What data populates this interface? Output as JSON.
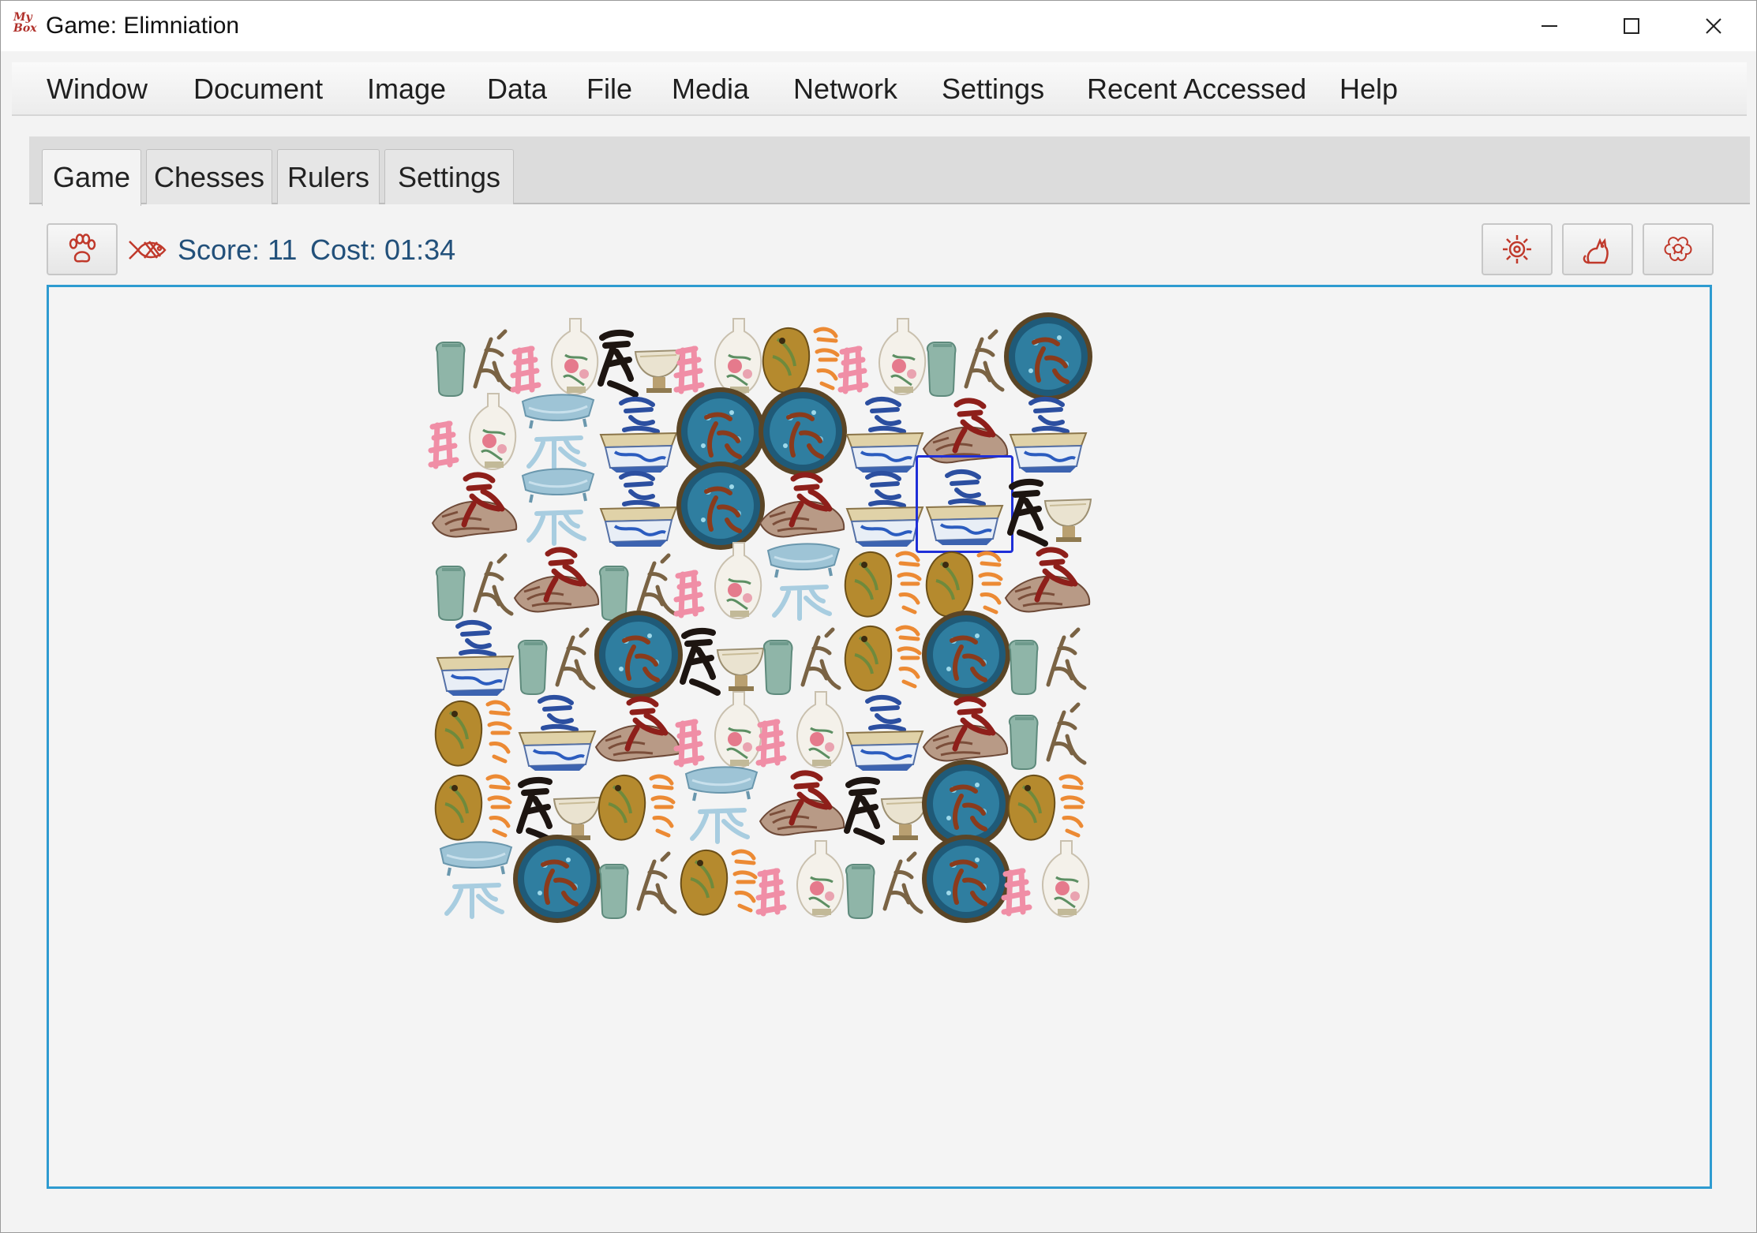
{
  "window": {
    "logo_text": "My Box",
    "title": "Game: Elimniation"
  },
  "menu": [
    "Window",
    "Document",
    "Image",
    "Data",
    "File",
    "Media",
    "Network",
    "Settings",
    "Recent Accessed",
    "Help"
  ],
  "tabs": [
    {
      "label": "Game",
      "active": true
    },
    {
      "label": "Chesses",
      "active": false
    },
    {
      "label": "Rulers",
      "active": false
    },
    {
      "label": "Settings",
      "active": false
    }
  ],
  "toolbar": {
    "left_button_icon": "paw-icon",
    "status_icon": "fish-icon",
    "score_text": "Score: 11",
    "cost_text": "Cost: 01:34",
    "right_buttons": [
      "gear-icon",
      "cat-icon",
      "peony-icon"
    ]
  },
  "colors": {
    "accent": "#c0392b",
    "board_border": "#2e9bd0",
    "selected_border": "#1f2fd8",
    "status_text": "#22507a"
  },
  "board": {
    "rows": 8,
    "cols": 8,
    "selected": {
      "row": 2,
      "col": 6
    },
    "piece_types": [
      "celadon-jar-piece",
      "famille-rose-vase-piece",
      "crackle-bowl-piece",
      "oil-spot-bowl-piece",
      "bronze-fish-vessel-piece",
      "blue-white-basin-piece",
      "conch-shell-piece",
      "pale-dish-piece"
    ],
    "grid": [
      [
        0,
        1,
        2,
        1,
        4,
        1,
        0,
        3
      ],
      [
        1,
        7,
        5,
        3,
        3,
        5,
        6,
        5
      ],
      [
        6,
        7,
        5,
        3,
        6,
        5,
        5,
        2
      ],
      [
        0,
        6,
        0,
        1,
        7,
        4,
        4,
        6
      ],
      [
        5,
        0,
        3,
        2,
        0,
        4,
        3,
        0
      ],
      [
        4,
        5,
        6,
        1,
        1,
        5,
        6,
        0
      ],
      [
        4,
        2,
        4,
        7,
        6,
        2,
        3,
        4
      ],
      [
        7,
        3,
        0,
        4,
        1,
        0,
        3,
        1
      ]
    ]
  }
}
